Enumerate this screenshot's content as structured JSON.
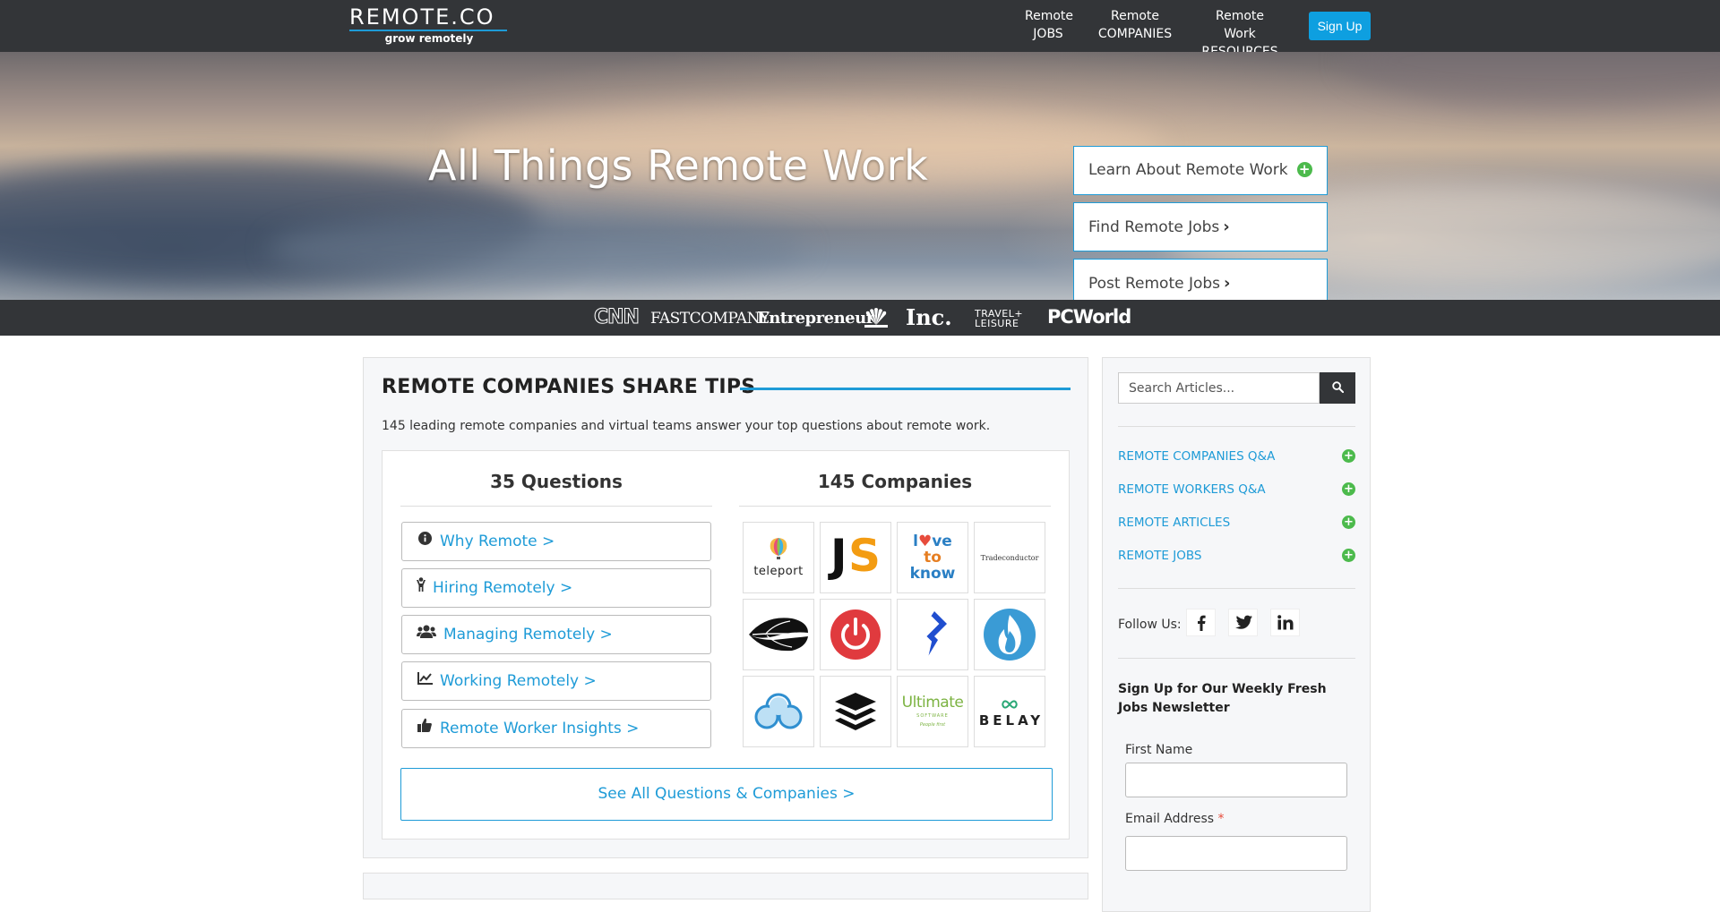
{
  "nav": {
    "logo": {
      "wordmark": "REMOTE.CO",
      "tagline": "grow remotely"
    },
    "links": [
      {
        "line1": "Remote",
        "line2": "JOBS"
      },
      {
        "line1": "Remote",
        "line2": "COMPANIES"
      },
      {
        "line1": "Remote Work",
        "line2": "RESOURCES"
      }
    ],
    "signup_label": "Sign Up"
  },
  "hero": {
    "title": "All Things Remote Work",
    "buttons": [
      {
        "label": "Learn About Remote Work",
        "icon": "plus-circle-icon"
      },
      {
        "label": "Find Remote Jobs",
        "icon": "chevron-right-icon"
      },
      {
        "label": "Post Remote Jobs",
        "icon": "chevron-right-icon"
      }
    ]
  },
  "press": {
    "logos": [
      "CNN",
      "FAST COMPANY",
      "Entrepreneur",
      "NBC",
      "Inc.",
      "TRAVEL+ LEISURE",
      "PCWorld"
    ],
    "display": {
      "cnn": "CNN",
      "fast": "FASTCOMPANY",
      "ent": "Entrepreneur",
      "inc": "Inc.",
      "tl1": "TRAVEL+",
      "tl2": "LEISURE",
      "pcw": "PCWorld"
    }
  },
  "main": {
    "title": "REMOTE COMPANIES SHARE TIPS",
    "intro": "145 leading remote companies and virtual teams answer your top questions about remote work.",
    "questions_heading": "35 Questions",
    "companies_heading": "145 Companies",
    "questions": [
      {
        "label": "Why Remote >",
        "icon": "info-circle-icon"
      },
      {
        "label": "Hiring Remotely >",
        "icon": "person-icon"
      },
      {
        "label": "Managing Remotely >",
        "icon": "users-icon"
      },
      {
        "label": "Working Remotely >",
        "icon": "line-chart-icon"
      },
      {
        "label": "Remote Worker Insights >",
        "icon": "thumbs-up-icon"
      }
    ],
    "companies": [
      {
        "name": "teleport",
        "text": "teleport"
      },
      {
        "name": "JS",
        "text": "JS"
      },
      {
        "name": "love to know",
        "text1": "l ve",
        "text2": "to",
        "text3": "know"
      },
      {
        "name": "Tradeconductor",
        "text": "Tradeconductor"
      },
      {
        "name": "leaf logo"
      },
      {
        "name": "power logo"
      },
      {
        "name": "toptal"
      },
      {
        "name": "flame logo"
      },
      {
        "name": "cloud logo"
      },
      {
        "name": "buffer"
      },
      {
        "name": "Ultimate Software",
        "text1": "Ultimate",
        "text2": "SOFTWARE",
        "text3": "People first"
      },
      {
        "name": "BELAY",
        "text": "BELAY"
      }
    ],
    "see_all_label": "See All Questions & Companies >"
  },
  "sidebar": {
    "search_placeholder": "Search Articles...",
    "links": [
      "REMOTE COMPANIES Q&A",
      "REMOTE WORKERS Q&A",
      "REMOTE ARTICLES",
      "REMOTE JOBS"
    ],
    "follow_label": "Follow Us:",
    "social": [
      "facebook",
      "twitter",
      "linkedin"
    ],
    "newsletter_title": "Sign Up for Our Weekly Fresh Jobs Newsletter",
    "first_name_label": "First Name",
    "email_label": "Email Address",
    "required_mark": "*"
  },
  "colors": {
    "accent": "#1e9bd7",
    "signup": "#0e9fe0",
    "plus_green": "#4cba4c",
    "nav_bg": "#333538"
  }
}
